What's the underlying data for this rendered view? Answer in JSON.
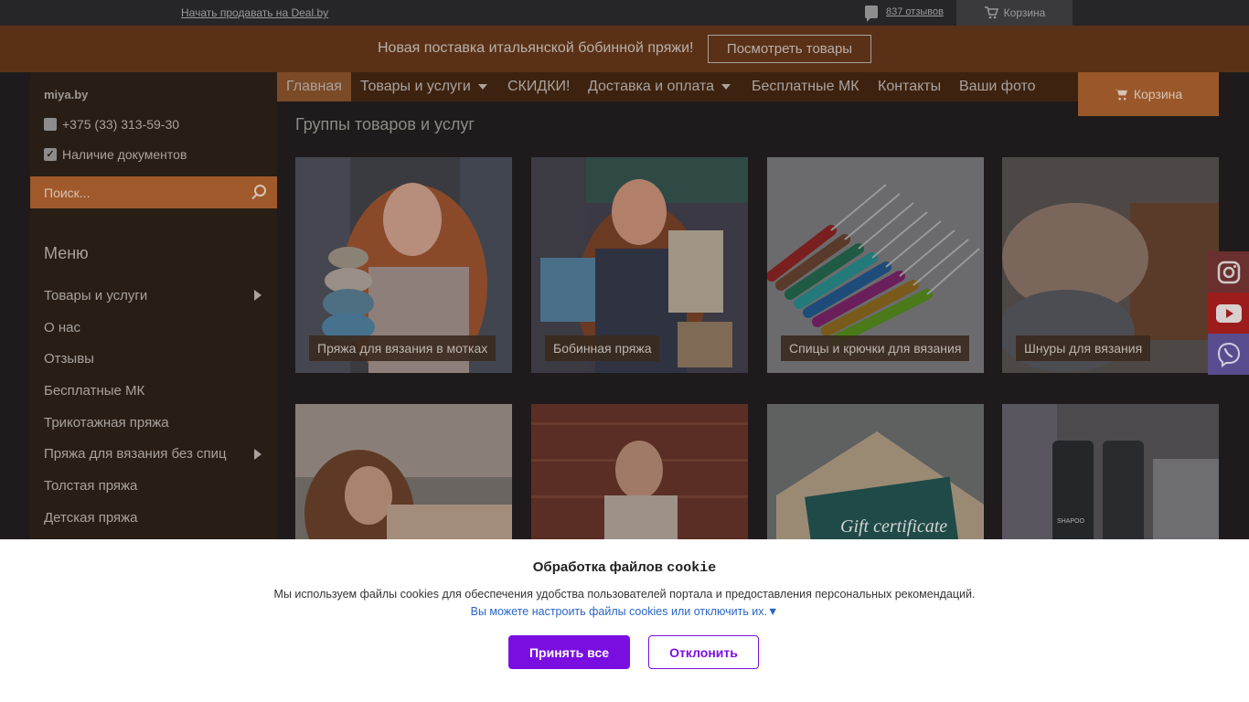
{
  "topbar": {
    "sell_link": "Начать продавать на Deal.by",
    "reviews": "837 отзывов",
    "cart": "Корзина"
  },
  "banner": {
    "text": "Новая поставка итальянской бобинной пряжи!",
    "button": "Посмотреть товары"
  },
  "sidebar": {
    "site": "miya.by",
    "phone": "+375 (33) 313-59-30",
    "docs": "Наличие документов",
    "search_placeholder": "Поиск...",
    "menu_title": "Меню",
    "items": [
      {
        "label": "Товары и услуги",
        "has_sub": true
      },
      {
        "label": "О нас"
      },
      {
        "label": "Отзывы"
      },
      {
        "label": "Бесплатные МК"
      },
      {
        "label": "Трикотажная пряжа"
      },
      {
        "label": "Пряжа для вязания без спиц",
        "has_sub": true
      },
      {
        "label": "Толстая пряжа"
      },
      {
        "label": "Детская пряжа"
      }
    ]
  },
  "nav": {
    "items": [
      "Главная",
      "Товары и услуги",
      "СКИДКИ!",
      "Доставка и оплата",
      "Бесплатные МК",
      "Контакты",
      "Ваши фото"
    ],
    "cart": "Корзина"
  },
  "groups": {
    "title": "Группы товаров и услуг",
    "tiles": [
      {
        "caption": "Пряжа для вязания в мотках"
      },
      {
        "caption": "Бобинная пряжа"
      },
      {
        "caption": "Спицы и крючки для вязания"
      },
      {
        "caption": "Шнуры для вязания"
      },
      {
        "caption": ""
      },
      {
        "caption": ""
      },
      {
        "caption": "",
        "image_text": "Gift certificate"
      },
      {
        "caption": "",
        "image_text": "SHAPOO"
      }
    ]
  },
  "social": {
    "colors": {
      "instagram": "#6a2f2f",
      "youtube": "#9c1c1c",
      "viber": "#5a4d8f"
    }
  },
  "cookie": {
    "title_main": "Обработка файлов",
    "title_code": "cookie",
    "text": "Мы используем файлы cookies для обеспечения удобства пользователей портала и предоставления персональных рекомендаций.",
    "link": "Вы можете настроить файлы cookies или отключить их.▼",
    "accept": "Принять все",
    "decline": "Отклонить"
  }
}
